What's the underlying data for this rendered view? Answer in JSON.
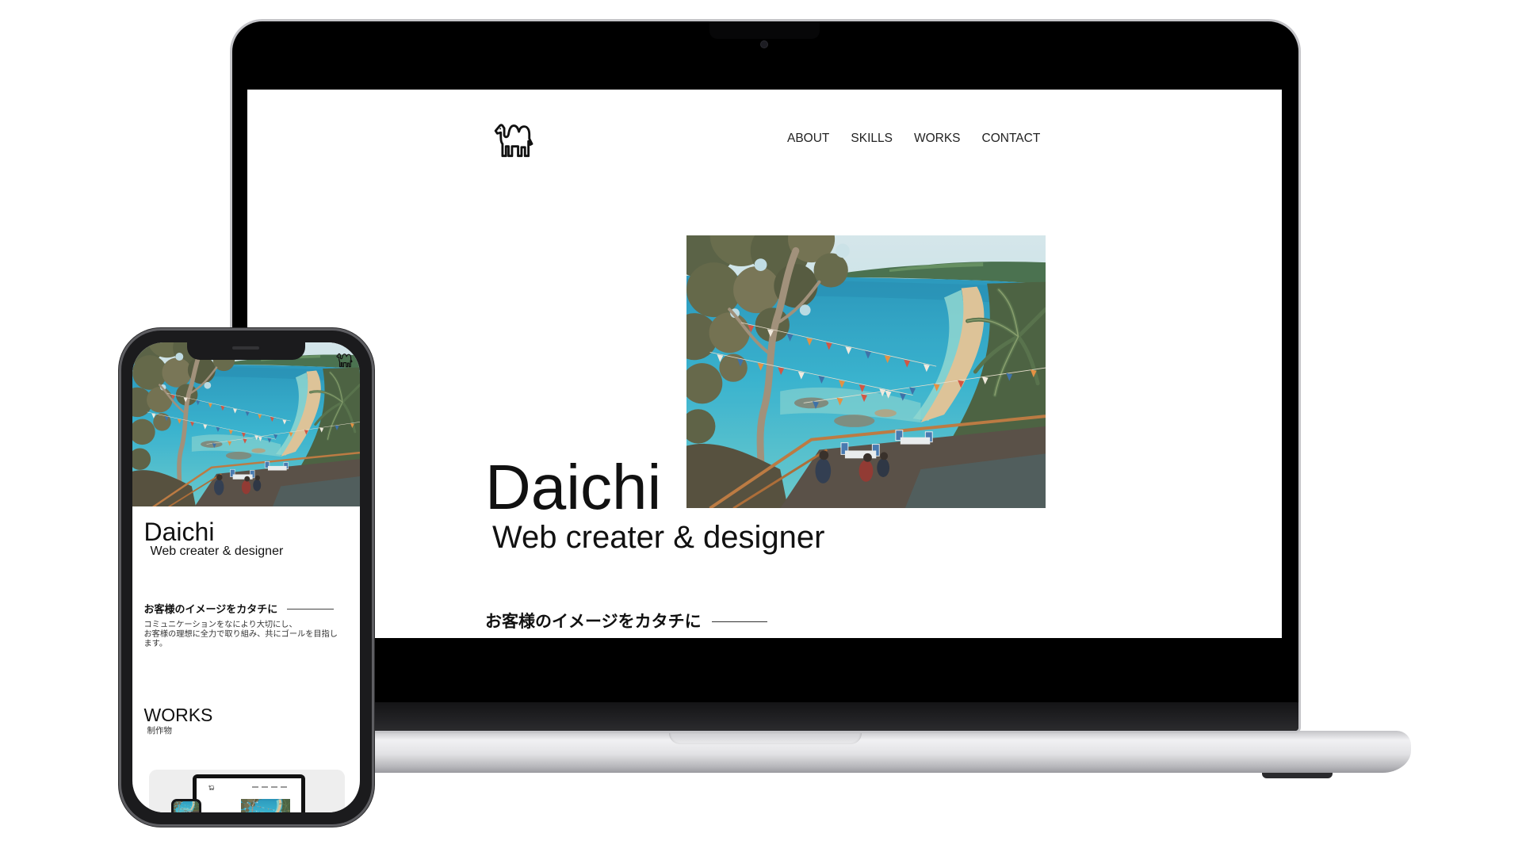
{
  "laptop": {
    "screen": {
      "logo_icon": "camel-icon",
      "nav": [
        {
          "label": "ABOUT"
        },
        {
          "label": "SKILLS"
        },
        {
          "label": "WORKS"
        },
        {
          "label": "CONTACT"
        }
      ],
      "hero": {
        "name": "Daichi",
        "tagline": "Web creater & designer"
      },
      "section_heading": "お客様のイメージをカタチに"
    }
  },
  "phone": {
    "logo_icon": "camel-icon",
    "hero": {
      "name": "Daichi",
      "tagline": "Web creater & designer"
    },
    "section_heading": "お客様のイメージをカタチに",
    "paragraph_lines": [
      "コミュニケーションをなにより大切にし、",
      "お客様の理想に全力で取り組み、共にゴールを目指し",
      "ます。"
    ],
    "works": {
      "title": "WORKS",
      "subtitle": "制作物"
    }
  },
  "colors": {
    "text": "#111111",
    "page_background": "#ffffff",
    "device_frame": "#000000",
    "device_silver": "#d6d6d9"
  }
}
